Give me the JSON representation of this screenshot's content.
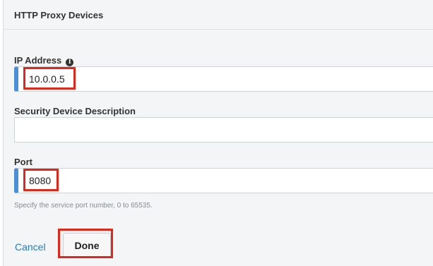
{
  "header": {
    "title": "HTTP Proxy Devices"
  },
  "ip_field": {
    "label": "IP Address",
    "info_icon": "info-icon",
    "value": "10.0.0.5"
  },
  "description_field": {
    "label": "Security Device Description",
    "value": ""
  },
  "port_field": {
    "label": "Port",
    "value": "8080",
    "hint": "Specify the service port number, 0 to 65535."
  },
  "actions": {
    "cancel_label": "Cancel",
    "done_label": "Done"
  },
  "colors": {
    "accent": "#4a90d9",
    "highlight": "#e0271a",
    "link": "#2a7ab8"
  }
}
